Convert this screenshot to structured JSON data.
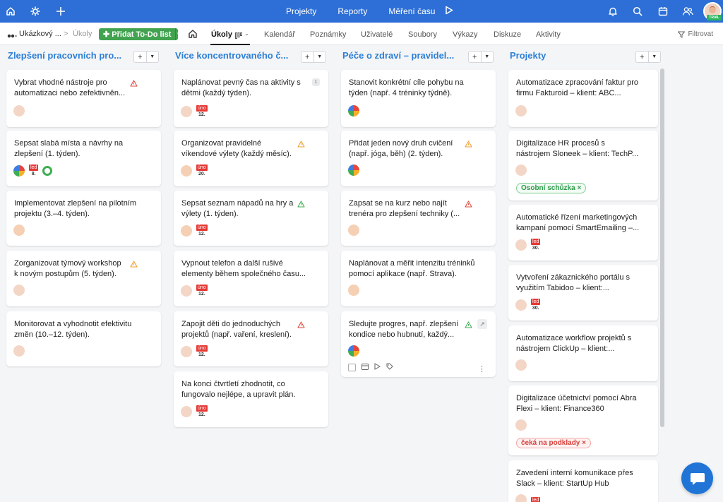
{
  "topbar": {
    "nav": [
      "Projekty",
      "Reporty",
      "Měření času"
    ],
    "trial_label": "TRIAL"
  },
  "subbar": {
    "project_name": "Ukázkový ...",
    "breadcrumb_sep": ">",
    "breadcrumb_current": "Úkoly",
    "add_button": "Přidat To-Do list",
    "tabs": [
      "Úkoly",
      "Kalendář",
      "Poznámky",
      "Uživatelé",
      "Soubory",
      "Výkazy",
      "Diskuze",
      "Aktivity"
    ],
    "filter_label": "Filtrovat"
  },
  "columns": [
    {
      "title": "Zlepšení pracovních pro...",
      "cards": [
        {
          "text": [
            "Vybrat vhodné nástroje pro",
            "automatizaci nebo zefektivněn..."
          ]
        },
        {
          "text": [
            "Sepsat slabá místa a návrhy na",
            "zlepšení (1. týden)."
          ],
          "date_month": "led",
          "date_day": "8."
        },
        {
          "text": [
            "Implementovat zlepšení na pilotním",
            "projektu (3.–4. týden)."
          ]
        },
        {
          "text": [
            "Zorganizovat týmový workshop",
            "k novým postupům (5. týden)."
          ]
        },
        {
          "text": [
            "Monitorovat a vyhodnotit efektivitu",
            "změn (10.–12. týden)."
          ]
        }
      ]
    },
    {
      "title": "Více koncentrovaného č...",
      "cards": [
        {
          "text": [
            "Naplánovat pevný čas na aktivity s",
            "dětmi (každý týden)."
          ],
          "date_month": "úno",
          "date_day": "12.",
          "count": "1"
        },
        {
          "text": [
            "Organizovat pravidelné",
            "víkendové výlety (každý měsíc)."
          ],
          "date_month": "úno",
          "date_day": "20."
        },
        {
          "text": [
            "Sepsat seznam nápadů na hry a",
            "výlety (1. týden)."
          ],
          "date_month": "úno",
          "date_day": "12."
        },
        {
          "text": [
            "Vypnout telefon a další rušivé",
            "elementy během společného času..."
          ],
          "date_month": "úno",
          "date_day": "12."
        },
        {
          "text": [
            "Zapojit děti do jednoduchých",
            "projektů (např. vaření, kreslení)."
          ],
          "date_month": "úno",
          "date_day": "12."
        },
        {
          "text": [
            "Na konci čtvrtletí zhodnotit, co",
            "fungovalo nejlépe, a upravit plán."
          ],
          "date_month": "úno",
          "date_day": "12."
        }
      ]
    },
    {
      "title": "Péče o zdraví – pravidel...",
      "cards": [
        {
          "text": [
            "Stanovit konkrétní cíle pohybu na",
            "týden (např. 4 tréninky týdně)."
          ]
        },
        {
          "text": [
            "Přidat jeden nový druh cvičení",
            "(např. jóga, běh) (2. týden)."
          ]
        },
        {
          "text": [
            "Zapsat se na kurz nebo najít",
            "trenéra pro zlepšení techniky (..."
          ]
        },
        {
          "text": [
            "Naplánovat a měřit intenzitu tréninků",
            "pomocí aplikace (např. Strava)."
          ]
        },
        {
          "text": [
            "Sledujte progres, např. zlepšení",
            "kondice nebo hubnutí, každý..."
          ]
        }
      ]
    },
    {
      "title": "Projekty",
      "cards": [
        {
          "text": [
            "Automatizace zpracování faktur pro",
            "firmu Fakturoid – klient: ABC..."
          ]
        },
        {
          "text": [
            "Digitalizace HR procesů s",
            "nástrojem Sloneek – klient: TechP..."
          ],
          "tag": "Osobní schůzka"
        },
        {
          "text": [
            "Automatické řízení marketingových",
            "kampaní pomocí SmartEmailing –..."
          ],
          "date_month": "led",
          "date_day": "30."
        },
        {
          "text": [
            "Vytvoření zákaznického portálu s",
            "využitím Tabidoo – klient:..."
          ],
          "date_month": "led",
          "date_day": "30."
        },
        {
          "text": [
            "Automatizace workflow projektů s",
            "nástrojem ClickUp – klient:..."
          ]
        },
        {
          "text": [
            "Digitalizace účetnictví pomocí Abra",
            "Flexi – klient: Finance360"
          ],
          "tag": "čeká na podklady"
        },
        {
          "text": [
            "Zavedení interní komunikace přes",
            "Slack – klient: StartUp Hub"
          ],
          "date_month": "led"
        }
      ]
    }
  ],
  "colors": {
    "topbar": "#2d6fd6",
    "column_title": "#2d7fd6",
    "add_button": "#41a34f",
    "date_badge": "#e53935"
  }
}
